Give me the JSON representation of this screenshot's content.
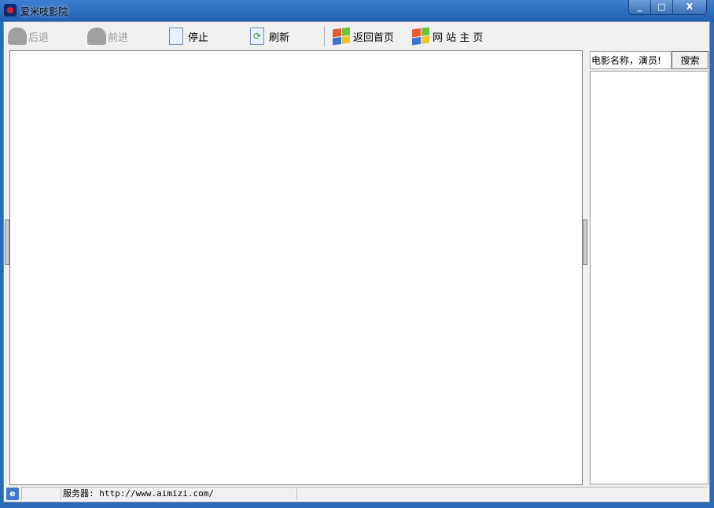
{
  "window": {
    "title": "爱米吱影院",
    "controls": [
      "minimize",
      "maximize",
      "close"
    ]
  },
  "toolbar": {
    "back": "后退",
    "forward": "前进",
    "stop": "停止",
    "refresh": "刷新",
    "home": "返回首页",
    "site": "网 站 主 页"
  },
  "search": {
    "value": "电影名称，演员!",
    "button": "搜索"
  },
  "status": {
    "server": "服务器: http://www.aimizi.com/"
  }
}
